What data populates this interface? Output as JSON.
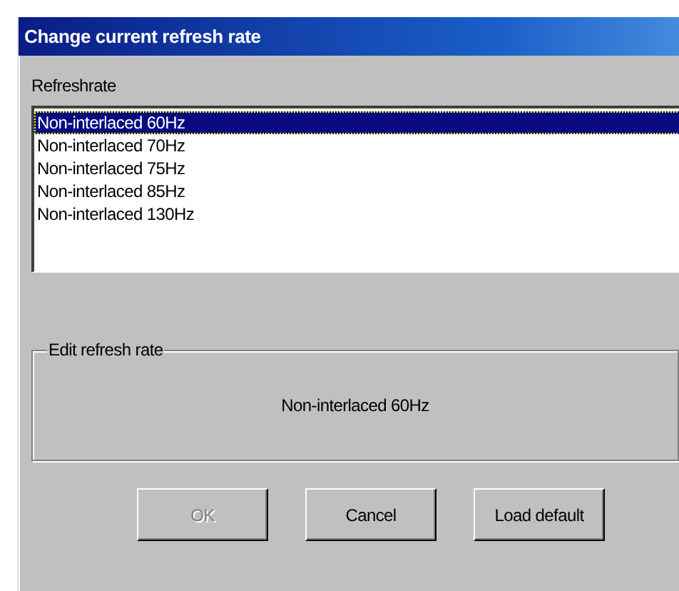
{
  "window": {
    "title": "Change current refresh rate"
  },
  "list": {
    "label": "Refreshrate",
    "items": [
      {
        "text": "Non-interlaced 60Hz",
        "selected": true
      },
      {
        "text": "Non-interlaced 70Hz",
        "selected": false
      },
      {
        "text": "Non-interlaced 75Hz",
        "selected": false
      },
      {
        "text": "Non-interlaced 85Hz",
        "selected": false
      },
      {
        "text": "Non-interlaced 130Hz",
        "selected": false
      }
    ]
  },
  "group": {
    "title": "Edit refresh rate",
    "value": "Non-interlaced 60Hz"
  },
  "buttons": [
    {
      "label": "OK",
      "disabled": true
    },
    {
      "label": "Cancel",
      "disabled": false
    },
    {
      "label": "Load default",
      "disabled": false
    }
  ]
}
